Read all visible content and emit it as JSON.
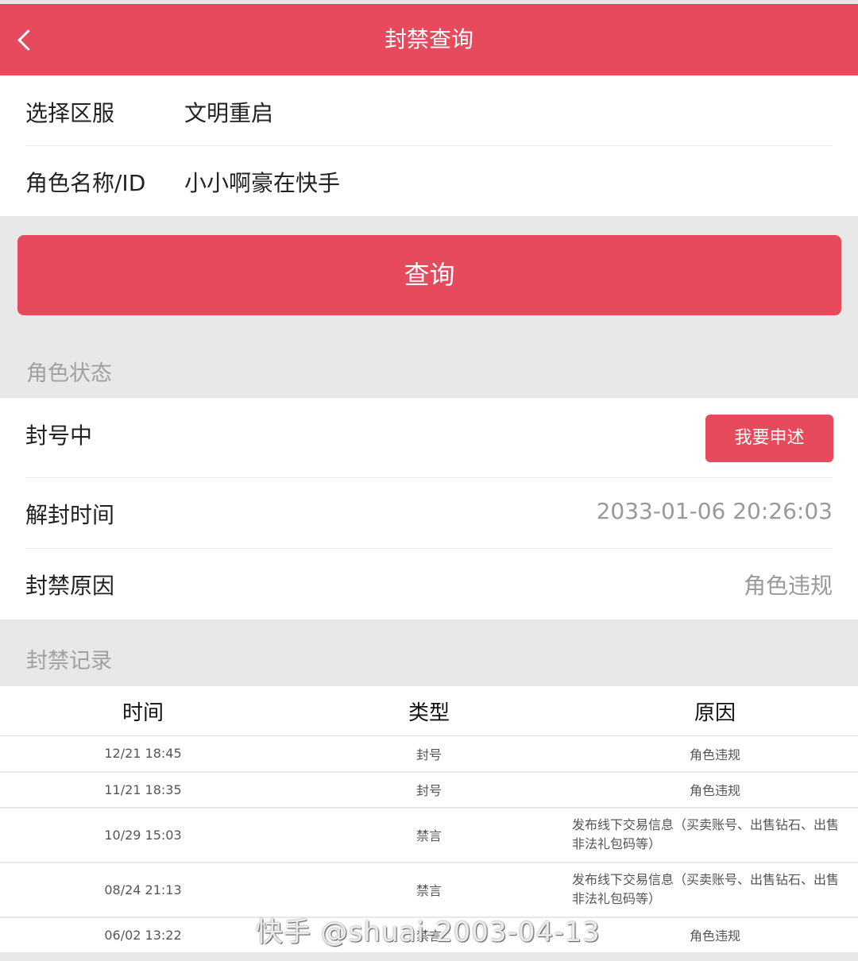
{
  "header": {
    "title": "封禁查询"
  },
  "form": {
    "server_label": "选择区服",
    "server_value": "文明重启",
    "role_label": "角色名称/ID",
    "role_value": "小小啊豪在快手"
  },
  "query_button": "查询",
  "status_section": {
    "title": "角色状态",
    "status_label": "封号中",
    "appeal_button": "我要申述",
    "unban_label": "解封时间",
    "unban_value": "2033-01-06 20:26:03",
    "reason_label": "封禁原因",
    "reason_value": "角色违规"
  },
  "records_section": {
    "title": "封禁记录",
    "columns": [
      "时间",
      "类型",
      "原因"
    ],
    "rows": [
      {
        "time": "12/21 18:45",
        "type": "封号",
        "reason": "角色违规"
      },
      {
        "time": "11/21 18:35",
        "type": "封号",
        "reason": "角色违规"
      },
      {
        "time": "10/29 15:03",
        "type": "禁言",
        "reason": "发布线下交易信息（买卖账号、出售钻石、出售非法礼包码等）"
      },
      {
        "time": "08/24 21:13",
        "type": "禁言",
        "reason": "发布线下交易信息（买卖账号、出售钻石、出售非法礼包码等）"
      },
      {
        "time": "06/02 13:22",
        "type": "禁言",
        "reason": "角色违规"
      }
    ]
  },
  "watermark": "快手 @shuai-2003-04-13",
  "colors": {
    "accent": "#e64a5c",
    "background": "#e8e8e8"
  },
  "icons": {
    "back": "chevron-left-icon"
  }
}
